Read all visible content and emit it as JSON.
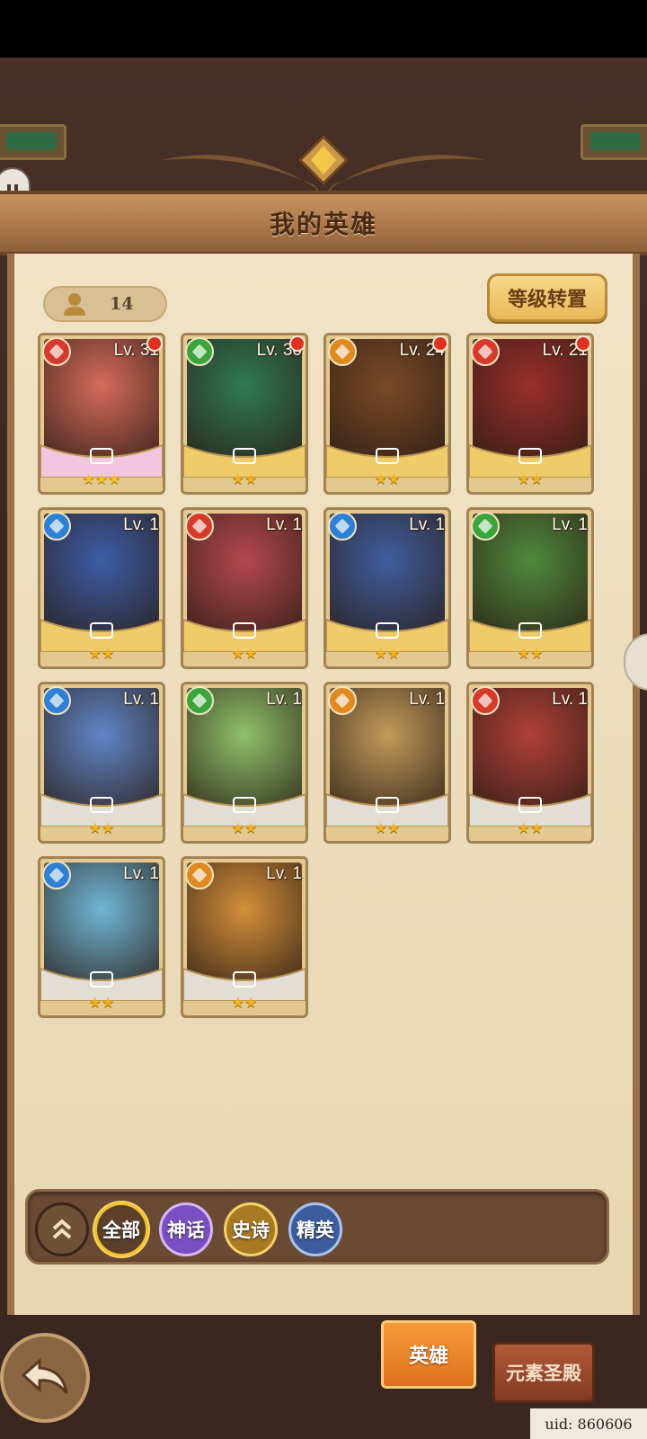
{
  "header": {
    "title": "我的英雄"
  },
  "hero_count": "14",
  "reset_button": "等级转置",
  "heroes": [
    {
      "level": "Lv. 31",
      "element": "fire",
      "stars": "★★★",
      "rarity": "mythic",
      "red_dot": true,
      "color": "#d66b5a"
    },
    {
      "level": "Lv. 30",
      "element": "wind",
      "stars": "★★",
      "rarity": "epic",
      "red_dot": true,
      "color": "#2f7a55"
    },
    {
      "level": "Lv. 24",
      "element": "earth",
      "stars": "★★",
      "rarity": "epic",
      "red_dot": true,
      "color": "#7a4a26"
    },
    {
      "level": "Lv. 21",
      "element": "fire",
      "stars": "★★",
      "rarity": "epic",
      "red_dot": true,
      "color": "#9a2e2a"
    },
    {
      "level": "Lv. 1",
      "element": "water",
      "stars": "★★",
      "rarity": "epic",
      "red_dot": false,
      "color": "#3c5da8"
    },
    {
      "level": "Lv. 1",
      "element": "fire",
      "stars": "★★",
      "rarity": "epic",
      "red_dot": false,
      "color": "#b5484e"
    },
    {
      "level": "Lv. 1",
      "element": "water",
      "stars": "★★",
      "rarity": "epic",
      "red_dot": false,
      "color": "#3f5ea0"
    },
    {
      "level": "Lv. 1",
      "element": "wind",
      "stars": "★★",
      "rarity": "epic",
      "red_dot": false,
      "color": "#4f8a3c"
    },
    {
      "level": "Lv. 1",
      "element": "water",
      "stars": "★★",
      "rarity": "rare",
      "red_dot": false,
      "color": "#5f86c8"
    },
    {
      "level": "Lv. 1",
      "element": "wind",
      "stars": "★★",
      "rarity": "rare",
      "red_dot": false,
      "color": "#8ec26a"
    },
    {
      "level": "Lv. 1",
      "element": "earth",
      "stars": "★★",
      "rarity": "rare",
      "red_dot": false,
      "color": "#c29b5a"
    },
    {
      "level": "Lv. 1",
      "element": "fire",
      "stars": "★★",
      "rarity": "rare",
      "red_dot": false,
      "color": "#b04038"
    },
    {
      "level": "Lv. 1",
      "element": "water",
      "stars": "★★",
      "rarity": "rare",
      "red_dot": false,
      "color": "#6fb6d6"
    },
    {
      "level": "Lv. 1",
      "element": "earth",
      "stars": "★★",
      "rarity": "rare",
      "red_dot": false,
      "color": "#d48f3a"
    }
  ],
  "element_colors": {
    "fire": "#d63a2a",
    "wind": "#3aa53a",
    "earth": "#e08a1e",
    "water": "#2e7fd6"
  },
  "filters": {
    "all": "全部",
    "mythic": "神话",
    "epic": "史诗",
    "elite": "精英"
  },
  "tabs": {
    "hero": "英雄",
    "temple": "元素圣殿"
  },
  "uid": "uid: 860606"
}
